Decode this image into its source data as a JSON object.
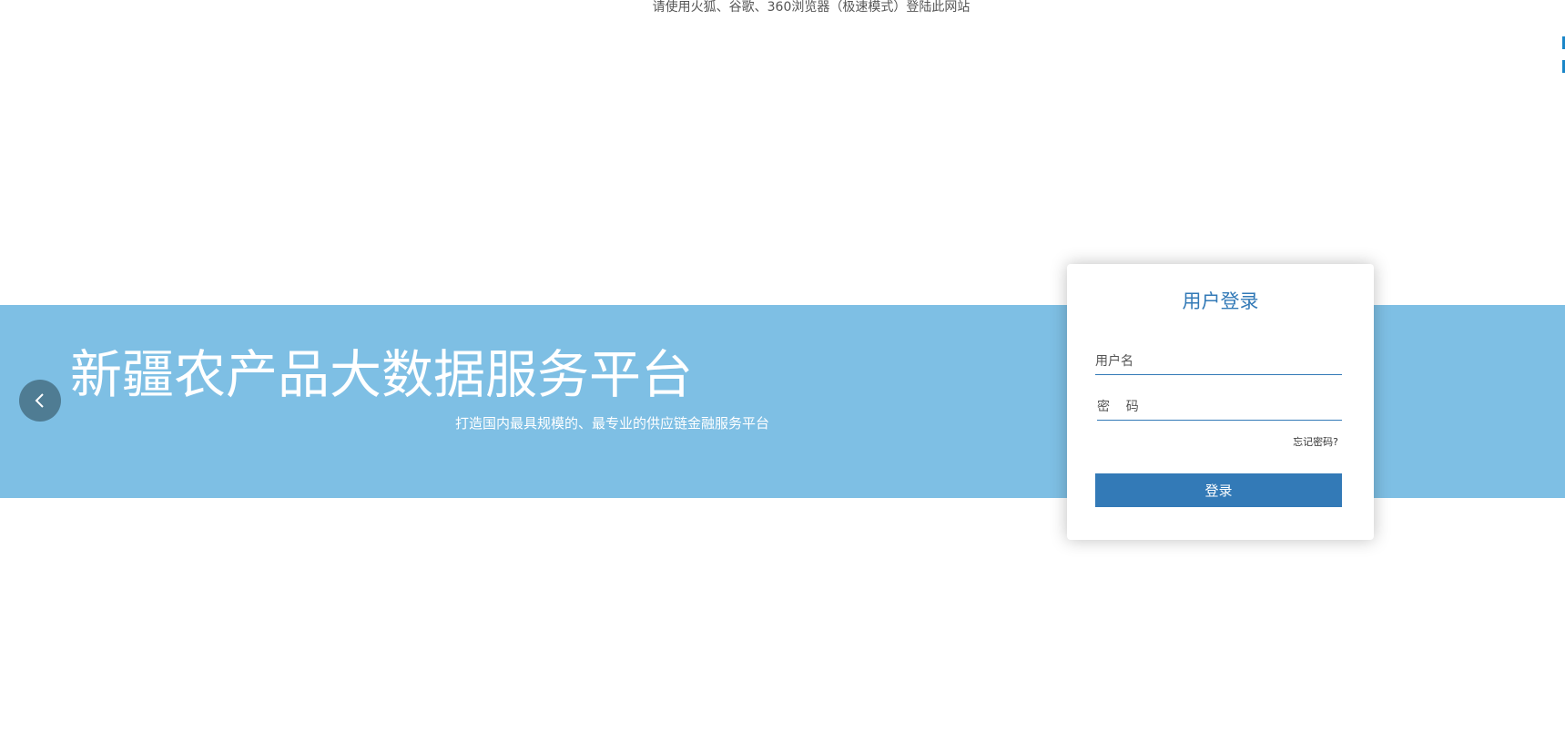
{
  "notice": {
    "browser_hint": "请使用火狐、谷歌、360浏览器（极速模式）登陆此网站"
  },
  "banner": {
    "title": "新疆农产品大数据服务平台",
    "subtitle": "打造国内最具规模的、最专业的供应链金融服务平台",
    "background_color": "#7ebfe4",
    "prev_icon": "chevron-left-icon"
  },
  "login": {
    "title": "用户登录",
    "username_placeholder": "用户名",
    "password_placeholder": "密    码",
    "forgot_password": "忘记密码?",
    "submit_label": "登录",
    "accent_color": "#337ab7"
  }
}
